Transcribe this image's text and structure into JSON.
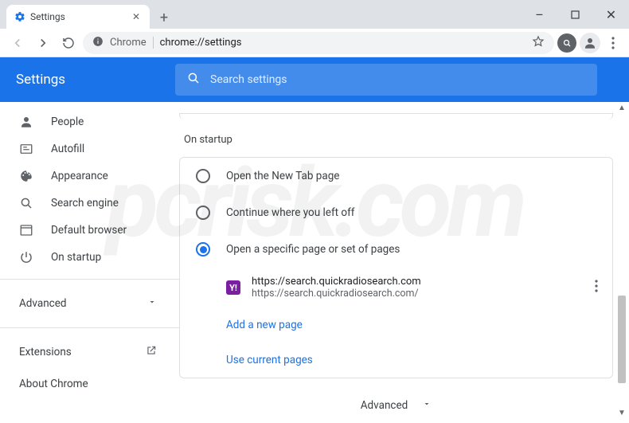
{
  "window": {
    "tab_title": "Settings",
    "minimize": "–",
    "maximize": "☐",
    "close": "✕",
    "newtab": "+",
    "tab_close": "✕"
  },
  "omnibox": {
    "scheme_label": "Chrome",
    "url_text": "chrome://settings"
  },
  "header": {
    "title": "Settings",
    "search_placeholder": "Search settings"
  },
  "sidebar": {
    "items": [
      {
        "label": "People",
        "icon": "person"
      },
      {
        "label": "Autofill",
        "icon": "autofill"
      },
      {
        "label": "Appearance",
        "icon": "palette"
      },
      {
        "label": "Search engine",
        "icon": "search"
      },
      {
        "label": "Default browser",
        "icon": "browser"
      },
      {
        "label": "On startup",
        "icon": "power"
      }
    ],
    "advanced_label": "Advanced",
    "extensions_label": "Extensions",
    "about_label": "About Chrome"
  },
  "startup": {
    "section_title": "On startup",
    "options": [
      {
        "label": "Open the New Tab page",
        "selected": false
      },
      {
        "label": "Continue where you left off",
        "selected": false
      },
      {
        "label": "Open a specific page or set of pages",
        "selected": true
      }
    ],
    "page_entry": {
      "title": "https://search.quickradiosearch.com",
      "url": "https://search.quickradiosearch.com/",
      "fav_letter": "Y!"
    },
    "add_page_label": "Add a new page",
    "use_current_label": "Use current pages"
  },
  "footer": {
    "advanced_label": "Advanced"
  },
  "watermark": "pcrisk.com"
}
